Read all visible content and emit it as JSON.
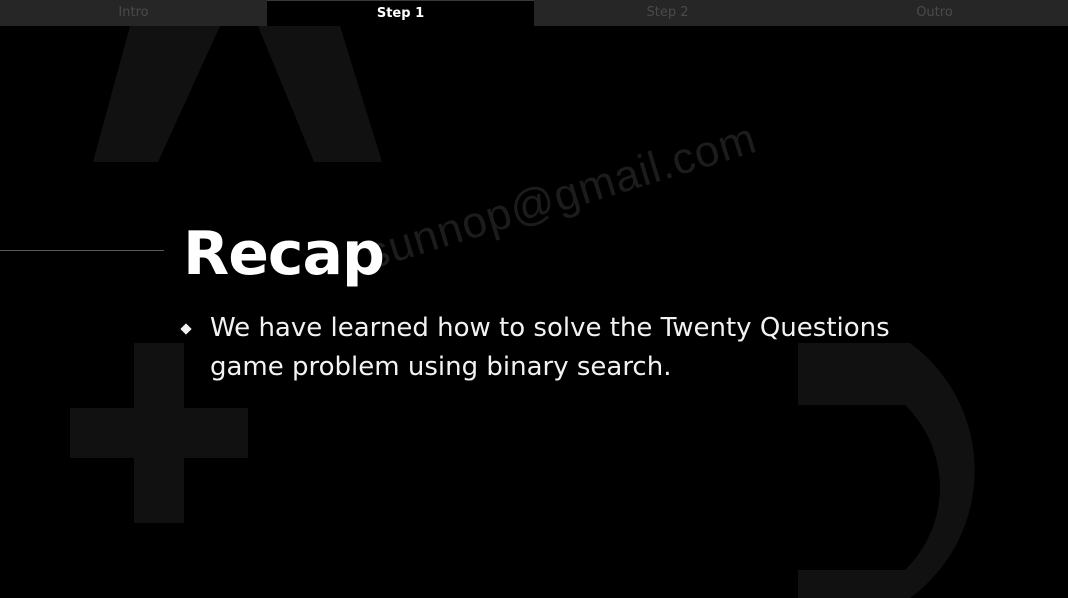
{
  "tabs": [
    {
      "label": "Intro",
      "active": false
    },
    {
      "label": "Step 1",
      "active": true
    },
    {
      "label": "Step 2",
      "active": false
    },
    {
      "label": "Outro",
      "active": false
    }
  ],
  "slide": {
    "title": "Recap",
    "bullets": [
      "We have learned how to solve the Twenty Questions game problem using binary search."
    ]
  },
  "watermark": "sunnop@gmail.com",
  "colors": {
    "background": "#000000",
    "tabbar": "#262626",
    "tab_inactive_text": "#4a4a4a",
    "tab_active_text": "#ffffff",
    "decor_shape": "#111111"
  }
}
